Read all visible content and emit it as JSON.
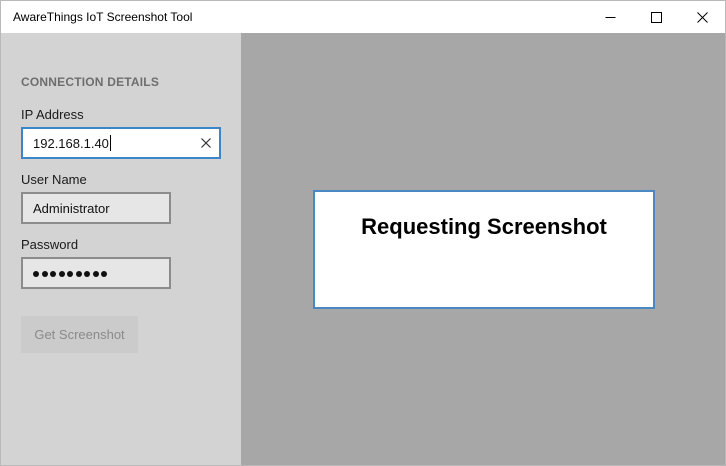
{
  "window": {
    "title": "AwareThings IoT Screenshot Tool",
    "controls": [
      "minimize-icon",
      "maximize-icon",
      "close-icon"
    ]
  },
  "sidebar": {
    "section_title": "CONNECTION DETAILS",
    "ip": {
      "label": "IP Address",
      "value": "192.168.1.40"
    },
    "user": {
      "label": "User Name",
      "value": "Administrator"
    },
    "password": {
      "label": "Password",
      "masked_length": 9
    },
    "get_button": "Get Screenshot"
  },
  "main": {
    "dialog_text": "Requesting Screenshot"
  },
  "colors": {
    "sidebar_bg": "#d3d3d3",
    "main_bg": "#a7a7a7",
    "accent": "#3a86c9"
  }
}
